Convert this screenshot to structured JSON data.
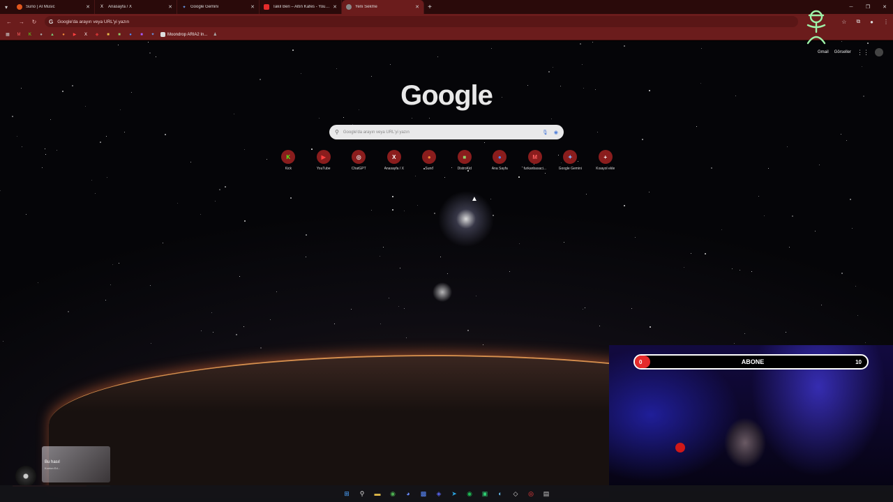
{
  "tabs": [
    {
      "title": "Suno | AI Music",
      "fav_color": "#e0561d",
      "active": false
    },
    {
      "title": "Anasayfa / X",
      "fav_color": "#000000",
      "active": false
    },
    {
      "title": "Google Gemini",
      "fav_color": "#6aa1f7",
      "active": false
    },
    {
      "title": "Takıl Beri – Altın Kafes - YouTub",
      "fav_color": "#e52b2b",
      "active": false
    },
    {
      "title": "Yeni Sekme",
      "fav_color": "#888888",
      "active": true
    }
  ],
  "omnibox": {
    "placeholder": "Google'da arayın veya URL'yi yazın"
  },
  "bookmarks": {
    "label": "Moondrop ARIA2 In..."
  },
  "toplinks": {
    "gmail": "Gmail",
    "images": "Görseller"
  },
  "logo": "Google",
  "search": {
    "placeholder": "Google'da arayın veya URL'yi yazın"
  },
  "shortcuts": [
    {
      "label": "Kick",
      "glyph": "K",
      "color": "#53fc18"
    },
    {
      "label": "YouTube",
      "glyph": "▶",
      "color": "#ff4040"
    },
    {
      "label": "ChatGPT",
      "glyph": "◎",
      "color": "#dddddd"
    },
    {
      "label": "Anasayfa / X",
      "glyph": "X",
      "color": "#ffffff"
    },
    {
      "label": "Suno",
      "glyph": "●",
      "color": "#f08a3a"
    },
    {
      "label": "DistroKid",
      "glyph": "■",
      "color": "#8fd16a"
    },
    {
      "label": "Ana Sayfa",
      "glyph": "●",
      "color": "#4a8cff"
    },
    {
      "label": "furkanbasaci...",
      "glyph": "M",
      "color": "#ff6060"
    },
    {
      "label": "Google Gemini",
      "glyph": "✦",
      "color": "#7fb3ff"
    },
    {
      "label": "Kısayol ekle",
      "glyph": "+",
      "color": "#ffffff"
    }
  ],
  "webcam": {
    "sub_count": "0",
    "label": "ABONE",
    "goal": "10",
    "sub_progress": 0
  },
  "music": {
    "song": "Bu hasıl",
    "artist": "Konton Ed...",
    "progress": 0.76
  },
  "colors": {
    "tabstrip": "#2a0a0a",
    "toolbar": "#6b1c1c",
    "accent": "#8a1d1d"
  }
}
